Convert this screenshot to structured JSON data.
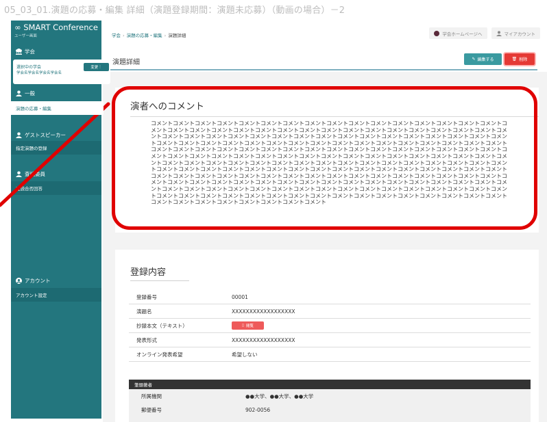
{
  "doc_title": "05_03_01.演題の応募・編集 詳細（演題登録期間：演題未応募）（動画の場合）－2",
  "sidebar": {
    "brand": "SMART Conference",
    "brand_sub": "ユーザー画面",
    "society_head": "学会",
    "society_card_label": "選択中の学会",
    "society_change": "変更",
    "society_names": "学会名学会名学会名学会名",
    "general_head": "一般",
    "general_item": "演題の応募・編集",
    "guest_head": "ゲストスピーカー",
    "guest_item": "指定演題の登録",
    "review_head": "査読委員",
    "review_item": "査読合否回答",
    "account_head": "アカウント",
    "account_item": "アカウント設定"
  },
  "breadcrumb": {
    "item1": "学会",
    "item2": "演題の応募・編集",
    "current": "演題詳細"
  },
  "top_links": {
    "homepage": "学会ホームページへ",
    "my_account": "マイアカウント"
  },
  "page_title": "演題詳細",
  "actions": {
    "edit": "編集する",
    "delete": "削除"
  },
  "comment": {
    "title": "演者へのコメント",
    "body": "コメントコメントコメントコメントコメントコメントコメントコメントコメントコメントコメントコメントコメントコメントコメントコメントコメントコメントコメントコメントコメントコメントコメントコメントコメントコメントコメントコメントコメントコメントコメントコメントコメントコメントコメントコメントコメントコメントコメントコメントコメントコメントコメントコメントコメントコメントコメントコメントコメントコメントコメントコメントコメントコメントコメントコメントコメントコメントコメントコメントコメントコメントコメントコメントコメントコメントコメントコメントコメントコメントコメントコメントコメントコメントコメントコメントコメントコメントコメントコメントコメントコメントコメントコメントコメントコメントコメントコメントコメントコメントコメントコメントコメントコメントコメントコメントコメントコメントコメントコメントコメントコメントコメントコメントコメントコメントコメントコメントコメントコメントコメントコメントコメントコメントコメントコメントコメントコメントコメントコメントコメントコメントコメントコメントコメントコメントコメントコメントコメントコメントコメントコメントコメントコメントコメントコメントコメントコメントコメントコメントコメントコメントコメントコメントコメントコメントコメントコメントコメントコメントコメントコメントコメントコメントコメントコメントコメントコメントコメントコメントコメントコメントコメントコメントコメントコメントコメントコメントコメントコメントコメントコメントコメントコメントコメントコメントコメントコメントコメントコメントコメントコメントコメントコメントコメントコメントコメントコメントコメントコメントコメントコメントコメントコメントコメントコメントコメントコメントコメントコメントコメントコメントコメント"
  },
  "registration": {
    "title": "登録内容",
    "rows": [
      {
        "label": "登録番号",
        "value": "00001"
      },
      {
        "label": "演題名",
        "value": "XXXXXXXXXXXXXXXXXX"
      },
      {
        "label": "抄録本文（テキスト）",
        "value": "閲覧"
      },
      {
        "label": "発表形式",
        "value": "XXXXXXXXXXXXXXXXXX"
      },
      {
        "label": "オンライン発表希望",
        "value": "希望しない"
      }
    ],
    "presenter_head": "筆頭著者",
    "presenter_rows": [
      {
        "label": "所属機関",
        "value": "●●大学、●●大学、●●大学"
      },
      {
        "label": "郵便番号",
        "value": "902-0056"
      }
    ]
  },
  "colors": {
    "sidebar": "#23767e",
    "accent": "#3a9aa0",
    "danger": "#e53935",
    "highlight": "#e00000"
  },
  "icons": [
    "society-icon",
    "person-icon",
    "guest-icon",
    "reviewer-icon",
    "account-icon",
    "edit-icon",
    "trash-icon",
    "file-icon",
    "home-dot-icon"
  ]
}
